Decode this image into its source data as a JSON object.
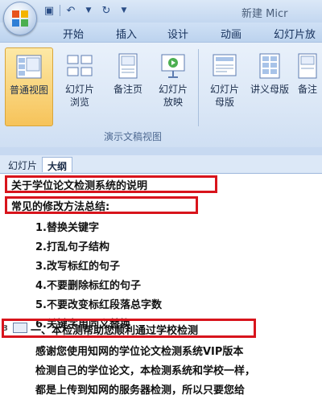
{
  "titlebar": {
    "title": "新建 Micr"
  },
  "ribbon_tabs": [
    "开始",
    "插入",
    "设计",
    "动画",
    "幻灯片放"
  ],
  "view_buttons": [
    {
      "label_line1": "普通视图",
      "label_line2": "",
      "icon": "normal-view-icon"
    },
    {
      "label_line1": "幻灯片",
      "label_line2": "浏览",
      "icon": "slide-sorter-icon"
    },
    {
      "label_line1": "备注页",
      "label_line2": "",
      "icon": "notes-page-icon"
    },
    {
      "label_line1": "幻灯片",
      "label_line2": "放映",
      "icon": "slide-show-icon"
    },
    {
      "label_line1": "幻灯片",
      "label_line2": "母版",
      "icon": "slide-master-icon"
    },
    {
      "label_line1": "讲义母版",
      "label_line2": "",
      "icon": "handout-master-icon"
    },
    {
      "label_line1": "备注",
      "label_line2": "",
      "icon": "notes-master-icon"
    }
  ],
  "group_label": "演示文稿视图",
  "pane_tabs": [
    "幻灯片",
    "大纲"
  ],
  "outline": {
    "line1": "关于学位论文检测系统的说明",
    "line2": "常见的修改方法总结:",
    "items": [
      "1.替换关键字",
      "2.打乱句子结构",
      "3.改写标红的句子",
      "4.不要删除标红的句子",
      "5.不要改变标红段落总字数",
      "6.关键字用同义替换"
    ],
    "slide3_number": "3",
    "slide3_title": "一、本检测帮助您顺利通过学校检测",
    "body": [
      "感谢您使用知网的学位论文检测系统VIP版本",
      "检测自己的学位论文，本检测系统和学校一样，",
      "都是上传到知网的服务器检测，所以只要您给"
    ]
  },
  "colors": {
    "highlight": "#d8141c",
    "active_button": "#f6c35a"
  }
}
